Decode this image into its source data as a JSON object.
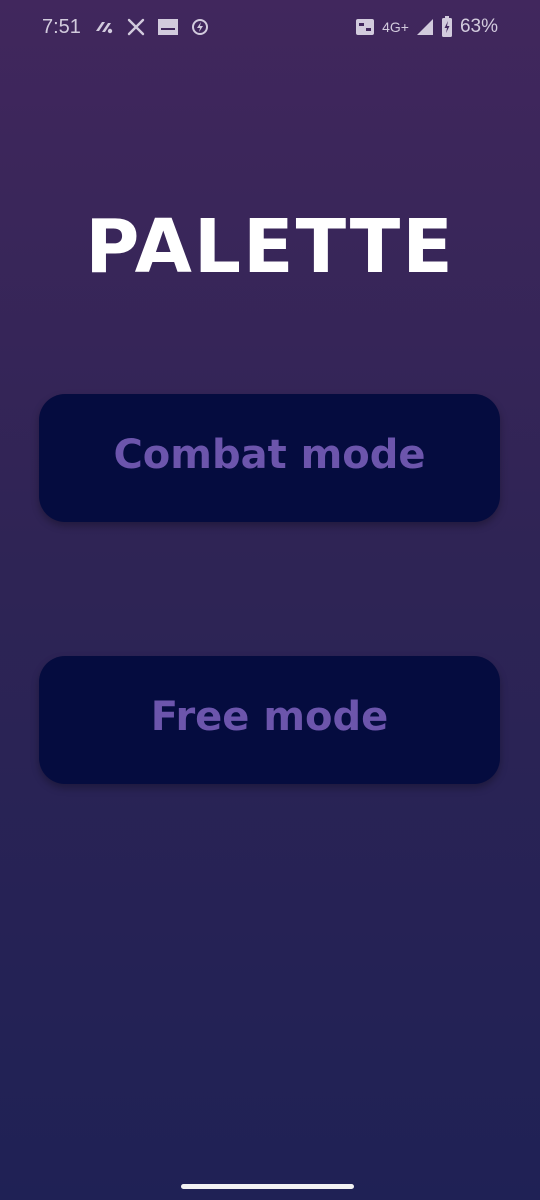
{
  "status_bar": {
    "time": "7:51",
    "network": "4G+",
    "battery": "63%",
    "notification_icons": [
      "app-notification-icon",
      "x-icon",
      "media-icon",
      "power-saver-icon"
    ],
    "system_icons": [
      "volte-icon",
      "signal-icon",
      "battery-icon"
    ]
  },
  "app": {
    "title": "PALETTE"
  },
  "menu": {
    "combat_label": "Combat mode",
    "free_label": "Free mode"
  },
  "colors": {
    "background_top": "#41275d",
    "background_bottom": "#1f2155",
    "button_background": "#050c3f",
    "button_text": "#6c55ac",
    "title_text": "#ffffff"
  }
}
